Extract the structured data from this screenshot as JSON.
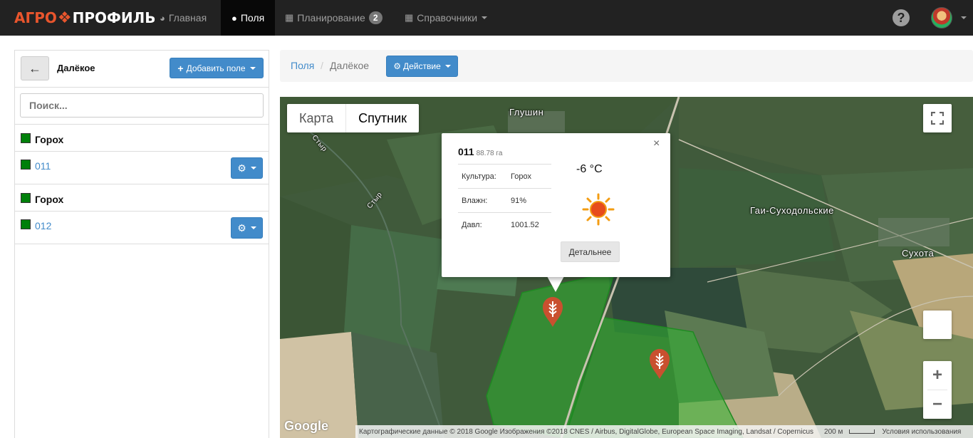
{
  "navbar": {
    "logo_left": "АГРО",
    "logo_right": "ПРОФИЛЬ",
    "items": [
      {
        "label": "Главная",
        "icon": "pie-chart-icon"
      },
      {
        "label": "Поля",
        "icon": "map-marker-icon",
        "active": true
      },
      {
        "label": "Планирование",
        "icon": "calendar-icon",
        "badge": "2"
      },
      {
        "label": "Справочники",
        "icon": "grid-icon"
      }
    ],
    "help": "?"
  },
  "sidebar": {
    "back": "←",
    "farm_name": "Далёкое",
    "add_field_label": "Добавить поле",
    "search_placeholder": "Поиск...",
    "groups": [
      {
        "name": "Горох",
        "field": "011",
        "color": "#00800a"
      },
      {
        "name": "Горох",
        "field": "012",
        "color": "#00800a"
      }
    ]
  },
  "breadcrumb": {
    "root": "Поля",
    "separator": "/",
    "current": "Далёкое",
    "action_label": "Действие"
  },
  "map": {
    "type_map": "Карта",
    "type_satellite": "Спутник",
    "labels": [
      "Глушин",
      "Гаи-Суходольские",
      "Сухота"
    ],
    "river_label": "Стыр",
    "google": "Google",
    "attribution": "Картографические данные © 2018 Google Изображения ©2018 CNES / Airbus, DigitalGlobe, European Space Imaging, Landsat / Copernicus",
    "scale": "200 м",
    "terms": "Условия использования",
    "zoom_in": "+",
    "zoom_out": "−"
  },
  "info_window": {
    "field": "011",
    "area": "88.78 га",
    "rows": [
      {
        "key": "Культура:",
        "value": "Горох"
      },
      {
        "key": "Влажн:",
        "value": "91%"
      },
      {
        "key": "Давл:",
        "value": "1001.52"
      }
    ],
    "temperature": "-6 °C",
    "details_label": "Детальнее",
    "close": "×"
  },
  "colors": {
    "primary": "#428bca",
    "navbar": "#222222",
    "field_green": "#00800a",
    "marker": "#c9502f"
  }
}
